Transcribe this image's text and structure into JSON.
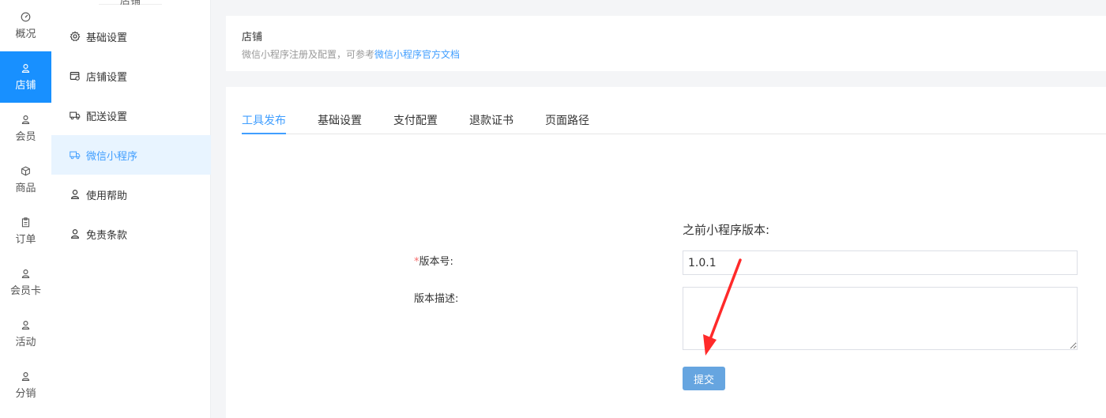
{
  "rail": [
    {
      "label": "概况",
      "icon": "dashboard-icon"
    },
    {
      "label": "店铺",
      "icon": "user-icon",
      "active": true
    },
    {
      "label": "会员",
      "icon": "user-icon"
    },
    {
      "label": "商品",
      "icon": "box-icon"
    },
    {
      "label": "订单",
      "icon": "clipboard-icon"
    },
    {
      "label": "会员卡",
      "icon": "user-icon"
    },
    {
      "label": "活动",
      "icon": "user-icon"
    },
    {
      "label": "分销",
      "icon": "user-icon"
    }
  ],
  "subnav": {
    "title": "店铺",
    "items": [
      {
        "label": "基础设置",
        "icon": "gear-icon"
      },
      {
        "label": "店铺设置",
        "icon": "shop-settings-icon"
      },
      {
        "label": "配送设置",
        "icon": "truck-icon"
      },
      {
        "label": "微信小程序",
        "icon": "truck-icon",
        "active": true
      },
      {
        "label": "使用帮助",
        "icon": "user-icon"
      },
      {
        "label": "免责条款",
        "icon": "user-icon"
      }
    ]
  },
  "header": {
    "title": "店铺",
    "subtitle_prefix": "微信小程序注册及配置，可参考",
    "subtitle_link": "微信小程序官方文档"
  },
  "tabs": [
    {
      "label": "工具发布",
      "active": true
    },
    {
      "label": "基础设置"
    },
    {
      "label": "支付配置"
    },
    {
      "label": "退款证书"
    },
    {
      "label": "页面路径"
    }
  ],
  "form": {
    "prev_version_label": "之前小程序版本:",
    "version_required_mark": "*",
    "version_label": "版本号:",
    "version_value": "1.0.1",
    "desc_label": "版本描述:",
    "desc_value": "",
    "submit_label": "提交"
  },
  "colors": {
    "accent": "#1890ff",
    "link": "#409eff",
    "button": "#66a5e0",
    "arrow": "#ff2a2a"
  }
}
